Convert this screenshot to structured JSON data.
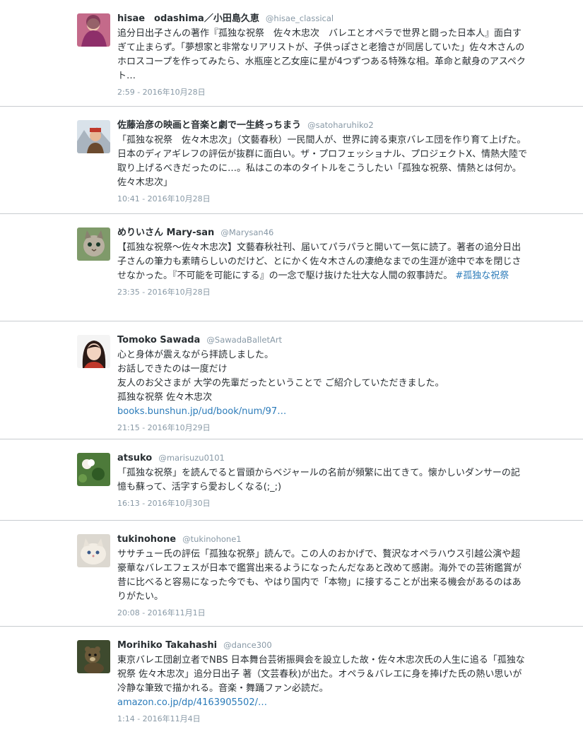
{
  "tweets": [
    {
      "name": "hisae　odashima／小田島久恵",
      "handle": "@hisae_classical",
      "text": "追分日出子さんの著作『孤独な祝祭　佐々木忠次　バレエとオペラで世界と闘った日本人』面白すぎて止まらず。「夢想家と非常なリアリストが、子供っぽさと老獪さが同居していた」佐々木さんのホロスコープを作ってみたら、水瓶座と乙女座に星が4つずつある特殊な相。革命と献身のアスペクト…",
      "time": "2:59 - 2016年10月28日"
    },
    {
      "name": "佐藤治彦の映画と音楽と劇で一生終っちまう",
      "handle": "@satoharuhiko2",
      "text": "「孤独な祝祭　佐々木忠次」（文藝春秋）一民間人が、世界に誇る東京バレエ団を作り育て上げた。日本のディアギレフの評伝が抜群に面白い。ザ・プロフェッショナル、プロジェクトX、情熱大陸で取り上げるべきだったのに…。私はこの本のタイトルをこうしたい「孤独な祝祭、情熱とは何か。佐々木忠次」",
      "time": "10:41 - 2016年10月28日"
    },
    {
      "name": "めりいさん Mary-san",
      "handle": "@Marysan46",
      "text": "【孤独な祝祭〜佐々木忠次】文藝春秋社刊、届いてパラパラと開いて一気に読了。著者の追分日出子さんの筆力も素晴らしいのだけど、とにかく佐々木さんの凄絶なまでの生涯が途中で本を閉じさせなかった。『不可能を可能にする』の一念で駆け抜けた壮大な人間の叙事詩だ。 ",
      "link": "#孤独な祝祭",
      "time": "23:35 - 2016年10月28日"
    },
    {
      "name": "Tomoko Sawada",
      "handle": "@SawadaBalletArt",
      "text": "心と身体が震えながら拝読しました。\nお話しできたのは一度だけ\n友人のお父さまが 大学の先輩だったということで ご紹介していただきました。\n孤独な祝祭 佐々木忠次\n",
      "link": "books.bunshun.jp/ud/book/num/97…",
      "time": "21:15 - 2016年10月29日"
    },
    {
      "name": "atsuko",
      "handle": "@marisuzu0101",
      "text": "「孤独な祝祭」を読んでると冒頭からベジャールの名前が頻繁に出てきて。懐かしいダンサーの記憶も蘇って、活字すら愛おしくなる(;_;)",
      "time": "16:13 - 2016年10月30日"
    },
    {
      "name": "tukinohone",
      "handle": "@tukinohone1",
      "text": "ササチュー氏の評伝「孤独な祝祭」読んで。この人のおかげで、贅沢なオペラハウス引越公演や超豪華なバレエフェスが日本で鑑賞出来るようになったんだなあと改めて感謝。海外での芸術鑑賞が昔に比べると容易になった今でも、やはり国内で「本物」に接することが出来る機会があるのはありがたい。",
      "time": "20:08 - 2016年11月1日"
    },
    {
      "name": "Morihiko Takahashi",
      "handle": "@dance300",
      "text": "東京バレエ団創立者でNBS 日本舞台芸術振興会を設立した故・佐々木忠次氏の人生に追る「孤独な祝祭 佐々木忠次」追分日出子 著（文芸春秋)が出た。オペラ＆バレエに身を捧げた氏の熱い思いが冷静な筆致で描かれる。音楽・舞踊ファン必読だ。\n",
      "link": "amazon.co.jp/dp/4163905502/…",
      "time": "1:14 - 2016年11月4日"
    }
  ]
}
